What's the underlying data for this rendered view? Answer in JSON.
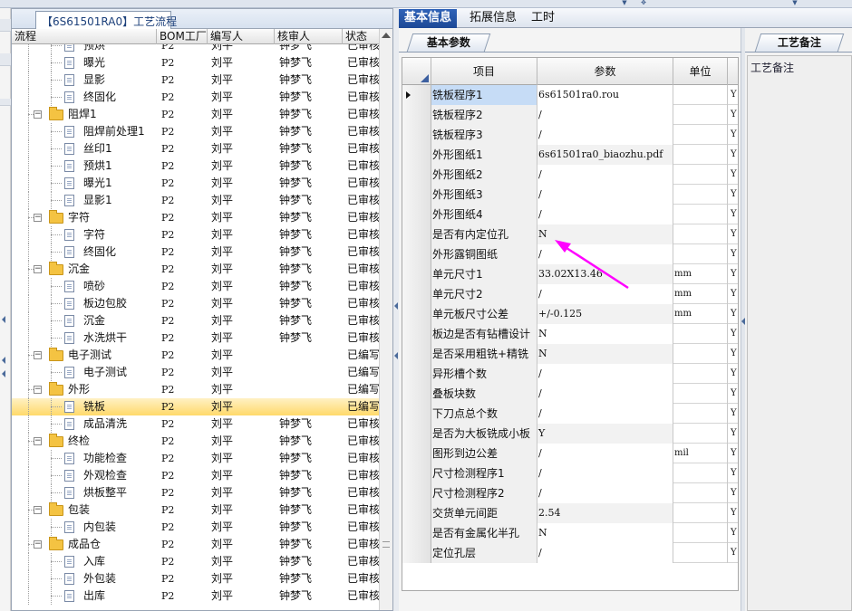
{
  "left_panel": {
    "tab_title": "【6S61501RA0】工艺流程",
    "columns": [
      "流程",
      "BOM工厂",
      "编写人",
      "核审人",
      "状态"
    ],
    "rows": [
      {
        "indent": 2,
        "type": "doc",
        "name": "预烘",
        "bom": "P2",
        "writer": "刘平",
        "reviewer": "钟梦飞",
        "status": "已审核"
      },
      {
        "indent": 2,
        "type": "doc",
        "name": "曝光",
        "bom": "P2",
        "writer": "刘平",
        "reviewer": "钟梦飞",
        "status": "已审核"
      },
      {
        "indent": 2,
        "type": "doc",
        "name": "显影",
        "bom": "P2",
        "writer": "刘平",
        "reviewer": "钟梦飞",
        "status": "已审核"
      },
      {
        "indent": 2,
        "type": "doc",
        "name": "终固化",
        "bom": "P2",
        "writer": "刘平",
        "reviewer": "钟梦飞",
        "status": "已审核"
      },
      {
        "indent": 1,
        "type": "folder",
        "name": "阻焊1",
        "bom": "P2",
        "writer": "刘平",
        "reviewer": "钟梦飞",
        "status": "已审核"
      },
      {
        "indent": 2,
        "type": "doc",
        "name": "阻焊前处理1",
        "bom": "P2",
        "writer": "刘平",
        "reviewer": "钟梦飞",
        "status": "已审核"
      },
      {
        "indent": 2,
        "type": "doc",
        "name": "丝印1",
        "bom": "P2",
        "writer": "刘平",
        "reviewer": "钟梦飞",
        "status": "已审核"
      },
      {
        "indent": 2,
        "type": "doc",
        "name": "预烘1",
        "bom": "P2",
        "writer": "刘平",
        "reviewer": "钟梦飞",
        "status": "已审核"
      },
      {
        "indent": 2,
        "type": "doc",
        "name": "曝光1",
        "bom": "P2",
        "writer": "刘平",
        "reviewer": "钟梦飞",
        "status": "已审核"
      },
      {
        "indent": 2,
        "type": "doc",
        "name": "显影1",
        "bom": "P2",
        "writer": "刘平",
        "reviewer": "钟梦飞",
        "status": "已审核"
      },
      {
        "indent": 1,
        "type": "folder",
        "name": "字符",
        "bom": "P2",
        "writer": "刘平",
        "reviewer": "钟梦飞",
        "status": "已审核"
      },
      {
        "indent": 2,
        "type": "doc",
        "name": "字符",
        "bom": "P2",
        "writer": "刘平",
        "reviewer": "钟梦飞",
        "status": "已审核"
      },
      {
        "indent": 2,
        "type": "doc",
        "name": "终固化",
        "bom": "P2",
        "writer": "刘平",
        "reviewer": "钟梦飞",
        "status": "已审核"
      },
      {
        "indent": 1,
        "type": "folder",
        "name": "沉金",
        "bom": "P2",
        "writer": "刘平",
        "reviewer": "钟梦飞",
        "status": "已审核"
      },
      {
        "indent": 2,
        "type": "doc",
        "name": "喷砂",
        "bom": "P2",
        "writer": "刘平",
        "reviewer": "钟梦飞",
        "status": "已审核"
      },
      {
        "indent": 2,
        "type": "doc",
        "name": "板边包胶",
        "bom": "P2",
        "writer": "刘平",
        "reviewer": "钟梦飞",
        "status": "已审核"
      },
      {
        "indent": 2,
        "type": "doc",
        "name": "沉金",
        "bom": "P2",
        "writer": "刘平",
        "reviewer": "钟梦飞",
        "status": "已审核"
      },
      {
        "indent": 2,
        "type": "doc",
        "name": "水洗烘干",
        "bom": "P2",
        "writer": "刘平",
        "reviewer": "钟梦飞",
        "status": "已审核"
      },
      {
        "indent": 1,
        "type": "folder",
        "name": "电子测试",
        "bom": "P2",
        "writer": "刘平",
        "reviewer": "",
        "status": "已编写"
      },
      {
        "indent": 2,
        "type": "doc",
        "name": "电子测试",
        "bom": "P2",
        "writer": "刘平",
        "reviewer": "",
        "status": "已编写"
      },
      {
        "indent": 1,
        "type": "folder",
        "name": "外形",
        "bom": "P2",
        "writer": "刘平",
        "reviewer": "",
        "status": "已编写"
      },
      {
        "indent": 2,
        "type": "doc",
        "name": "铣板",
        "bom": "P2",
        "writer": "刘平",
        "reviewer": "",
        "status": "已编写",
        "selected": true
      },
      {
        "indent": 2,
        "type": "doc",
        "name": "成品清洗",
        "bom": "P2",
        "writer": "刘平",
        "reviewer": "钟梦飞",
        "status": "已审核"
      },
      {
        "indent": 1,
        "type": "folder",
        "name": "终检",
        "bom": "P2",
        "writer": "刘平",
        "reviewer": "钟梦飞",
        "status": "已审核"
      },
      {
        "indent": 2,
        "type": "doc",
        "name": "功能检查",
        "bom": "P2",
        "writer": "刘平",
        "reviewer": "钟梦飞",
        "status": "已审核"
      },
      {
        "indent": 2,
        "type": "doc",
        "name": "外观检查",
        "bom": "P2",
        "writer": "刘平",
        "reviewer": "钟梦飞",
        "status": "已审核"
      },
      {
        "indent": 2,
        "type": "doc",
        "name": "烘板整平",
        "bom": "P2",
        "writer": "刘平",
        "reviewer": "钟梦飞",
        "status": "已审核"
      },
      {
        "indent": 1,
        "type": "folder",
        "name": "包装",
        "bom": "P2",
        "writer": "刘平",
        "reviewer": "钟梦飞",
        "status": "已审核"
      },
      {
        "indent": 2,
        "type": "doc",
        "name": "内包装",
        "bom": "P2",
        "writer": "刘平",
        "reviewer": "钟梦飞",
        "status": "已审核"
      },
      {
        "indent": 1,
        "type": "folder",
        "name": "成品仓",
        "bom": "P2",
        "writer": "刘平",
        "reviewer": "钟梦飞",
        "status": "已审核"
      },
      {
        "indent": 2,
        "type": "doc",
        "name": "入库",
        "bom": "P2",
        "writer": "刘平",
        "reviewer": "钟梦飞",
        "status": "已审核"
      },
      {
        "indent": 2,
        "type": "doc",
        "name": "外包装",
        "bom": "P2",
        "writer": "刘平",
        "reviewer": "钟梦飞",
        "status": "已审核"
      },
      {
        "indent": 2,
        "type": "doc",
        "name": "出库",
        "bom": "P2",
        "writer": "刘平",
        "reviewer": "钟梦飞",
        "status": "已审核"
      }
    ]
  },
  "main_tabs": [
    "基本信息",
    "拓展信息",
    "工时"
  ],
  "sub_tab": "基本参数",
  "grid": {
    "columns": [
      "项目",
      "参数",
      "单位"
    ],
    "rows": [
      {
        "name": "铣板程序1",
        "value": "6s61501ra0.rou",
        "unit": "",
        "flag": "Y",
        "current": true
      },
      {
        "name": "铣板程序2",
        "value": "/",
        "unit": "",
        "flag": "Y"
      },
      {
        "name": "铣板程序3",
        "value": "/",
        "unit": "",
        "flag": "Y"
      },
      {
        "name": "外形图纸1",
        "value": "6s61501ra0_biaozhu.pdf",
        "unit": "",
        "flag": "Y"
      },
      {
        "name": "外形图纸2",
        "value": "/",
        "unit": "",
        "flag": "Y"
      },
      {
        "name": "外形图纸3",
        "value": "/",
        "unit": "",
        "flag": "Y"
      },
      {
        "name": "外形图纸4",
        "value": "/",
        "unit": "",
        "flag": "Y"
      },
      {
        "name": "是否有内定位孔",
        "value": "N",
        "unit": "",
        "flag": "Y"
      },
      {
        "name": "外形露铜图纸",
        "value": "/",
        "unit": "",
        "flag": "Y"
      },
      {
        "name": "单元尺寸1",
        "value": "33.02X13.46",
        "unit": "mm",
        "flag": "Y"
      },
      {
        "name": "单元尺寸2",
        "value": "/",
        "unit": "mm",
        "flag": "Y"
      },
      {
        "name": "单元板尺寸公差",
        "value": "+/-0.125",
        "unit": "mm",
        "flag": "Y"
      },
      {
        "name": "板边是否有钻槽设计",
        "value": "N",
        "unit": "",
        "flag": "Y"
      },
      {
        "name": "是否采用粗铣+精铣",
        "value": "N",
        "unit": "",
        "flag": "Y"
      },
      {
        "name": "异形槽个数",
        "value": "/",
        "unit": "",
        "flag": "Y"
      },
      {
        "name": "叠板块数",
        "value": "/",
        "unit": "",
        "flag": "Y"
      },
      {
        "name": "下刀点总个数",
        "value": "/",
        "unit": "",
        "flag": "Y"
      },
      {
        "name": "是否为大板铣成小板",
        "value": "Y",
        "unit": "",
        "flag": "Y"
      },
      {
        "name": "图形到边公差",
        "value": "/",
        "unit": "mil",
        "flag": "Y"
      },
      {
        "name": "尺寸检测程序1",
        "value": "/",
        "unit": "",
        "flag": "Y"
      },
      {
        "name": "尺寸检测程序2",
        "value": "/",
        "unit": "",
        "flag": "Y"
      },
      {
        "name": "交货单元间距",
        "value": "2.54",
        "unit": "",
        "flag": "Y"
      },
      {
        "name": "是否有金属化半孔",
        "value": "N",
        "unit": "",
        "flag": "Y"
      },
      {
        "name": "定位孔层",
        "value": "/",
        "unit": "",
        "flag": "Y"
      }
    ]
  },
  "right_panel": {
    "tab": "工艺备注",
    "label": "工艺备注"
  },
  "colors": {
    "accent_tab": "#2f63b8",
    "selection": "#ffd96a",
    "annotation_arrow": "#ff00ff"
  }
}
